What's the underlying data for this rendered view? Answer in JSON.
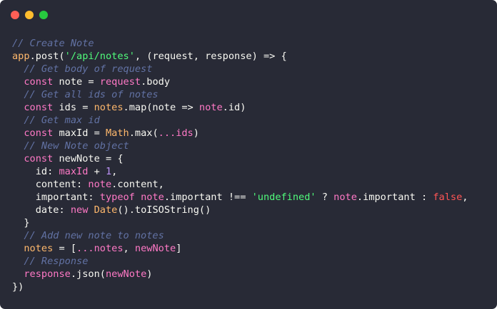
{
  "window": {
    "controls": [
      {
        "name": "close-button",
        "color": "#ff5f56"
      },
      {
        "name": "minimize-button",
        "color": "#ffbd2e"
      },
      {
        "name": "maximize-button",
        "color": "#27c93f"
      }
    ]
  },
  "colors": {
    "background": "#282a36",
    "comment": "#6272a4",
    "plain": "#f8f8f2",
    "ident": "#ffb86c",
    "keyword": "#ff79c6",
    "string": "#50fa7b",
    "number": "#bd93f9",
    "boolean": "#ff5555"
  },
  "code": {
    "lines": [
      [
        {
          "t": "comment",
          "v": "// Create Note"
        }
      ],
      [
        {
          "t": "ident",
          "v": "app"
        },
        {
          "t": "plain",
          "v": ".post("
        },
        {
          "t": "string",
          "v": "'/api/notes'"
        },
        {
          "t": "plain",
          "v": ", (request, response) => {"
        }
      ],
      [
        {
          "t": "plain",
          "v": "  "
        },
        {
          "t": "comment",
          "v": "// Get body of request"
        }
      ],
      [
        {
          "t": "plain",
          "v": "  "
        },
        {
          "t": "keyword",
          "v": "const"
        },
        {
          "t": "plain",
          "v": " note = "
        },
        {
          "t": "variable",
          "v": "request"
        },
        {
          "t": "plain",
          "v": ".body"
        }
      ],
      [
        {
          "t": "plain",
          "v": "  "
        },
        {
          "t": "comment",
          "v": "// Get all ids of notes"
        }
      ],
      [
        {
          "t": "plain",
          "v": "  "
        },
        {
          "t": "keyword",
          "v": "const"
        },
        {
          "t": "plain",
          "v": " ids = "
        },
        {
          "t": "ident",
          "v": "notes"
        },
        {
          "t": "plain",
          "v": ".map(note => "
        },
        {
          "t": "variable",
          "v": "note"
        },
        {
          "t": "plain",
          "v": ".id)"
        }
      ],
      [
        {
          "t": "plain",
          "v": "  "
        },
        {
          "t": "comment",
          "v": "// Get max id"
        }
      ],
      [
        {
          "t": "plain",
          "v": "  "
        },
        {
          "t": "keyword",
          "v": "const"
        },
        {
          "t": "plain",
          "v": " maxId = "
        },
        {
          "t": "ident",
          "v": "Math"
        },
        {
          "t": "plain",
          "v": ".max("
        },
        {
          "t": "variable",
          "v": "...ids"
        },
        {
          "t": "plain",
          "v": ")"
        }
      ],
      [
        {
          "t": "plain",
          "v": "  "
        },
        {
          "t": "comment",
          "v": "// New Note object"
        }
      ],
      [
        {
          "t": "plain",
          "v": "  "
        },
        {
          "t": "keyword",
          "v": "const"
        },
        {
          "t": "plain",
          "v": " newNote = {"
        }
      ],
      [
        {
          "t": "plain",
          "v": "    id: "
        },
        {
          "t": "variable",
          "v": "maxId"
        },
        {
          "t": "plain",
          "v": " + "
        },
        {
          "t": "number",
          "v": "1"
        },
        {
          "t": "plain",
          "v": ","
        }
      ],
      [
        {
          "t": "plain",
          "v": "    content: "
        },
        {
          "t": "variable",
          "v": "note"
        },
        {
          "t": "plain",
          "v": ".content,"
        }
      ],
      [
        {
          "t": "plain",
          "v": "    important: "
        },
        {
          "t": "keyword",
          "v": "typeof"
        },
        {
          "t": "plain",
          "v": " "
        },
        {
          "t": "variable",
          "v": "note"
        },
        {
          "t": "plain",
          "v": ".important !== "
        },
        {
          "t": "string",
          "v": "'undefined'"
        },
        {
          "t": "plain",
          "v": " ? "
        },
        {
          "t": "variable",
          "v": "note"
        },
        {
          "t": "plain",
          "v": ".important : "
        },
        {
          "t": "boolean",
          "v": "false"
        },
        {
          "t": "plain",
          "v": ","
        }
      ],
      [
        {
          "t": "plain",
          "v": "    date: "
        },
        {
          "t": "keyword",
          "v": "new"
        },
        {
          "t": "plain",
          "v": " "
        },
        {
          "t": "ident",
          "v": "Date"
        },
        {
          "t": "plain",
          "v": "().toISOString()"
        }
      ],
      [
        {
          "t": "plain",
          "v": "  }"
        }
      ],
      [
        {
          "t": "plain",
          "v": "  "
        },
        {
          "t": "comment",
          "v": "// Add new note to notes"
        }
      ],
      [
        {
          "t": "plain",
          "v": "  "
        },
        {
          "t": "ident",
          "v": "notes"
        },
        {
          "t": "plain",
          "v": " = ["
        },
        {
          "t": "variable",
          "v": "...notes"
        },
        {
          "t": "plain",
          "v": ", "
        },
        {
          "t": "variable",
          "v": "newNote"
        },
        {
          "t": "plain",
          "v": "]"
        }
      ],
      [
        {
          "t": "plain",
          "v": "  "
        },
        {
          "t": "comment",
          "v": "// Response"
        }
      ],
      [
        {
          "t": "plain",
          "v": "  "
        },
        {
          "t": "variable",
          "v": "response"
        },
        {
          "t": "plain",
          "v": ".json("
        },
        {
          "t": "variable",
          "v": "newNote"
        },
        {
          "t": "plain",
          "v": ")"
        }
      ],
      [
        {
          "t": "plain",
          "v": "})"
        }
      ]
    ]
  }
}
